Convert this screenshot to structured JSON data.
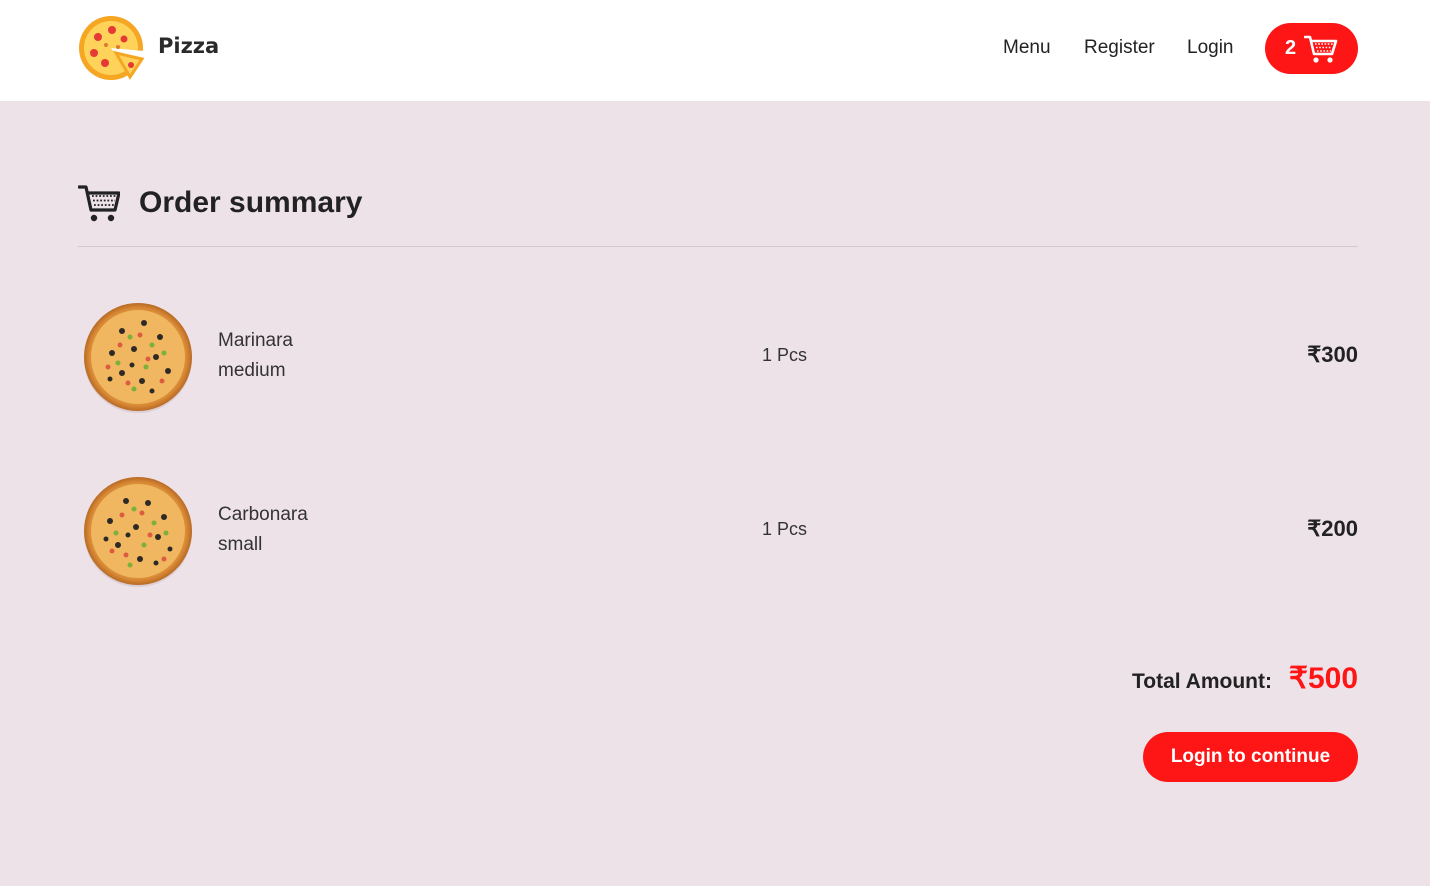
{
  "header": {
    "brand": "Pizza",
    "logo_icon": "pizza-slice-icon",
    "nav": [
      {
        "label": "Menu"
      },
      {
        "label": "Register"
      },
      {
        "label": "Login"
      }
    ],
    "cart": {
      "count": "2",
      "icon": "shopping-cart-icon"
    }
  },
  "summary": {
    "title": "Order summary",
    "icon": "shopping-cart-icon"
  },
  "items": [
    {
      "name": "Marinara",
      "size": "medium",
      "qty": "1 Pcs",
      "price": "₹300",
      "image_icon": "pizza-icon"
    },
    {
      "name": "Carbonara",
      "size": "small",
      "qty": "1 Pcs",
      "price": "₹200",
      "image_icon": "pizza-icon"
    }
  ],
  "total": {
    "label": "Total Amount:",
    "value": "₹500"
  },
  "login_button": "Login to continue",
  "colors": {
    "accent": "#fe1616",
    "background": "#ede2e8",
    "header": "#ffffff",
    "text": "#222222"
  }
}
